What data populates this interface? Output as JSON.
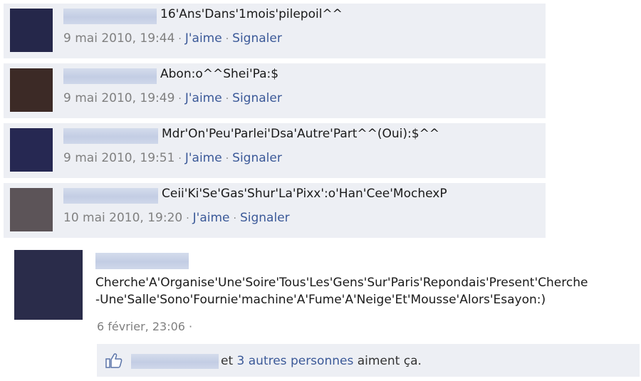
{
  "comments": [
    {
      "text": "16'Ans'Dans'1mois'pilepoil^^",
      "date": "9 mai 2010, 19:44",
      "like": "J'aime",
      "report": "Signaler",
      "avatar_color": "#25274a"
    },
    {
      "text": "Abon:o^^Shei'Pa:$",
      "date": "9 mai 2010, 19:49",
      "like": "J'aime",
      "report": "Signaler",
      "avatar_color": "#3c2a26"
    },
    {
      "text": "Mdr'On'Peu'Parlei'Dsa'Autre'Part^^(Oui):$^^",
      "date": "9 mai 2010, 19:51",
      "like": "J'aime",
      "report": "Signaler",
      "avatar_color": "#262852"
    },
    {
      "text": "Ceii'Ki'Se'Gas'Shur'La'Pixx':o'Han'Cee'MochexP",
      "date": "10 mai 2010, 19:20",
      "like": "J'aime",
      "report": "Signaler",
      "avatar_color": "#5c5458"
    }
  ],
  "post": {
    "line1": "Cherche'A'Organise'Une'Soire'Tous'Les'Gens'Sur'Paris'Repondais'Present'Cherche",
    "line2": "-Une'Salle'Sono'Fournie'machine'A'Fume'A'Neige'Et'Mousse'Alors'Esayon:)",
    "date": "6 février, 23:06",
    "separator": "·",
    "avatar_color": "#2a2c4a"
  },
  "likes": {
    "conjunction": "et",
    "others_link": "3 autres personnes",
    "suffix": "aiment ça.",
    "icon": "thumbs-up-icon"
  },
  "colors": {
    "link": "#3b5998",
    "bar": "#edeff4",
    "meta": "#808080"
  }
}
